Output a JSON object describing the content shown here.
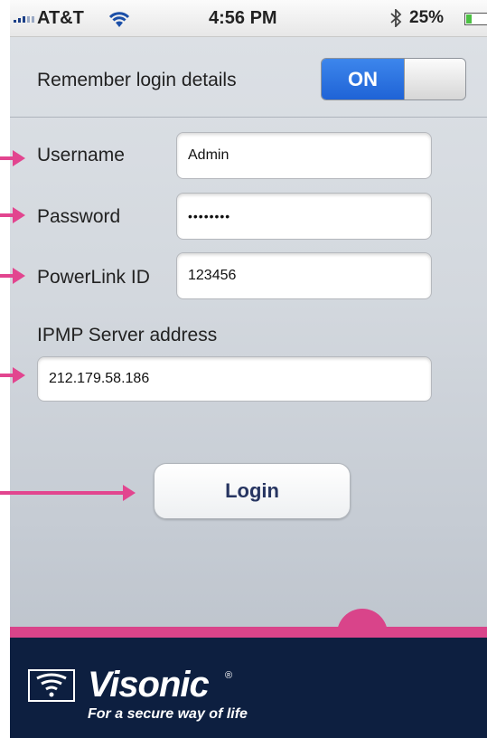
{
  "status_bar": {
    "carrier": "AT&T",
    "time": "4:56 PM",
    "battery_percent": "25%",
    "battery_level": 0.25,
    "icons": [
      "signal-icon",
      "wifi-icon",
      "bluetooth-icon",
      "battery-icon"
    ]
  },
  "remember": {
    "label": "Remember login details",
    "toggle_state": "ON"
  },
  "form": {
    "username_label": "Username",
    "username_value": "Admin",
    "password_label": "Password",
    "password_value": "••••••••",
    "powerlink_label": "PowerLink ID",
    "powerlink_value": "123456",
    "server_label": "IPMP Server address",
    "server_value": "212.179.58.186"
  },
  "login_button": "Login",
  "brand": {
    "name": "Visonic",
    "registered_mark": "®",
    "tagline": "For a secure way of life"
  },
  "colors": {
    "accent_pink": "#d9448a",
    "toggle_blue": "#2a70e0",
    "brand_navy": "#0d1f40",
    "button_text": "#273561"
  }
}
